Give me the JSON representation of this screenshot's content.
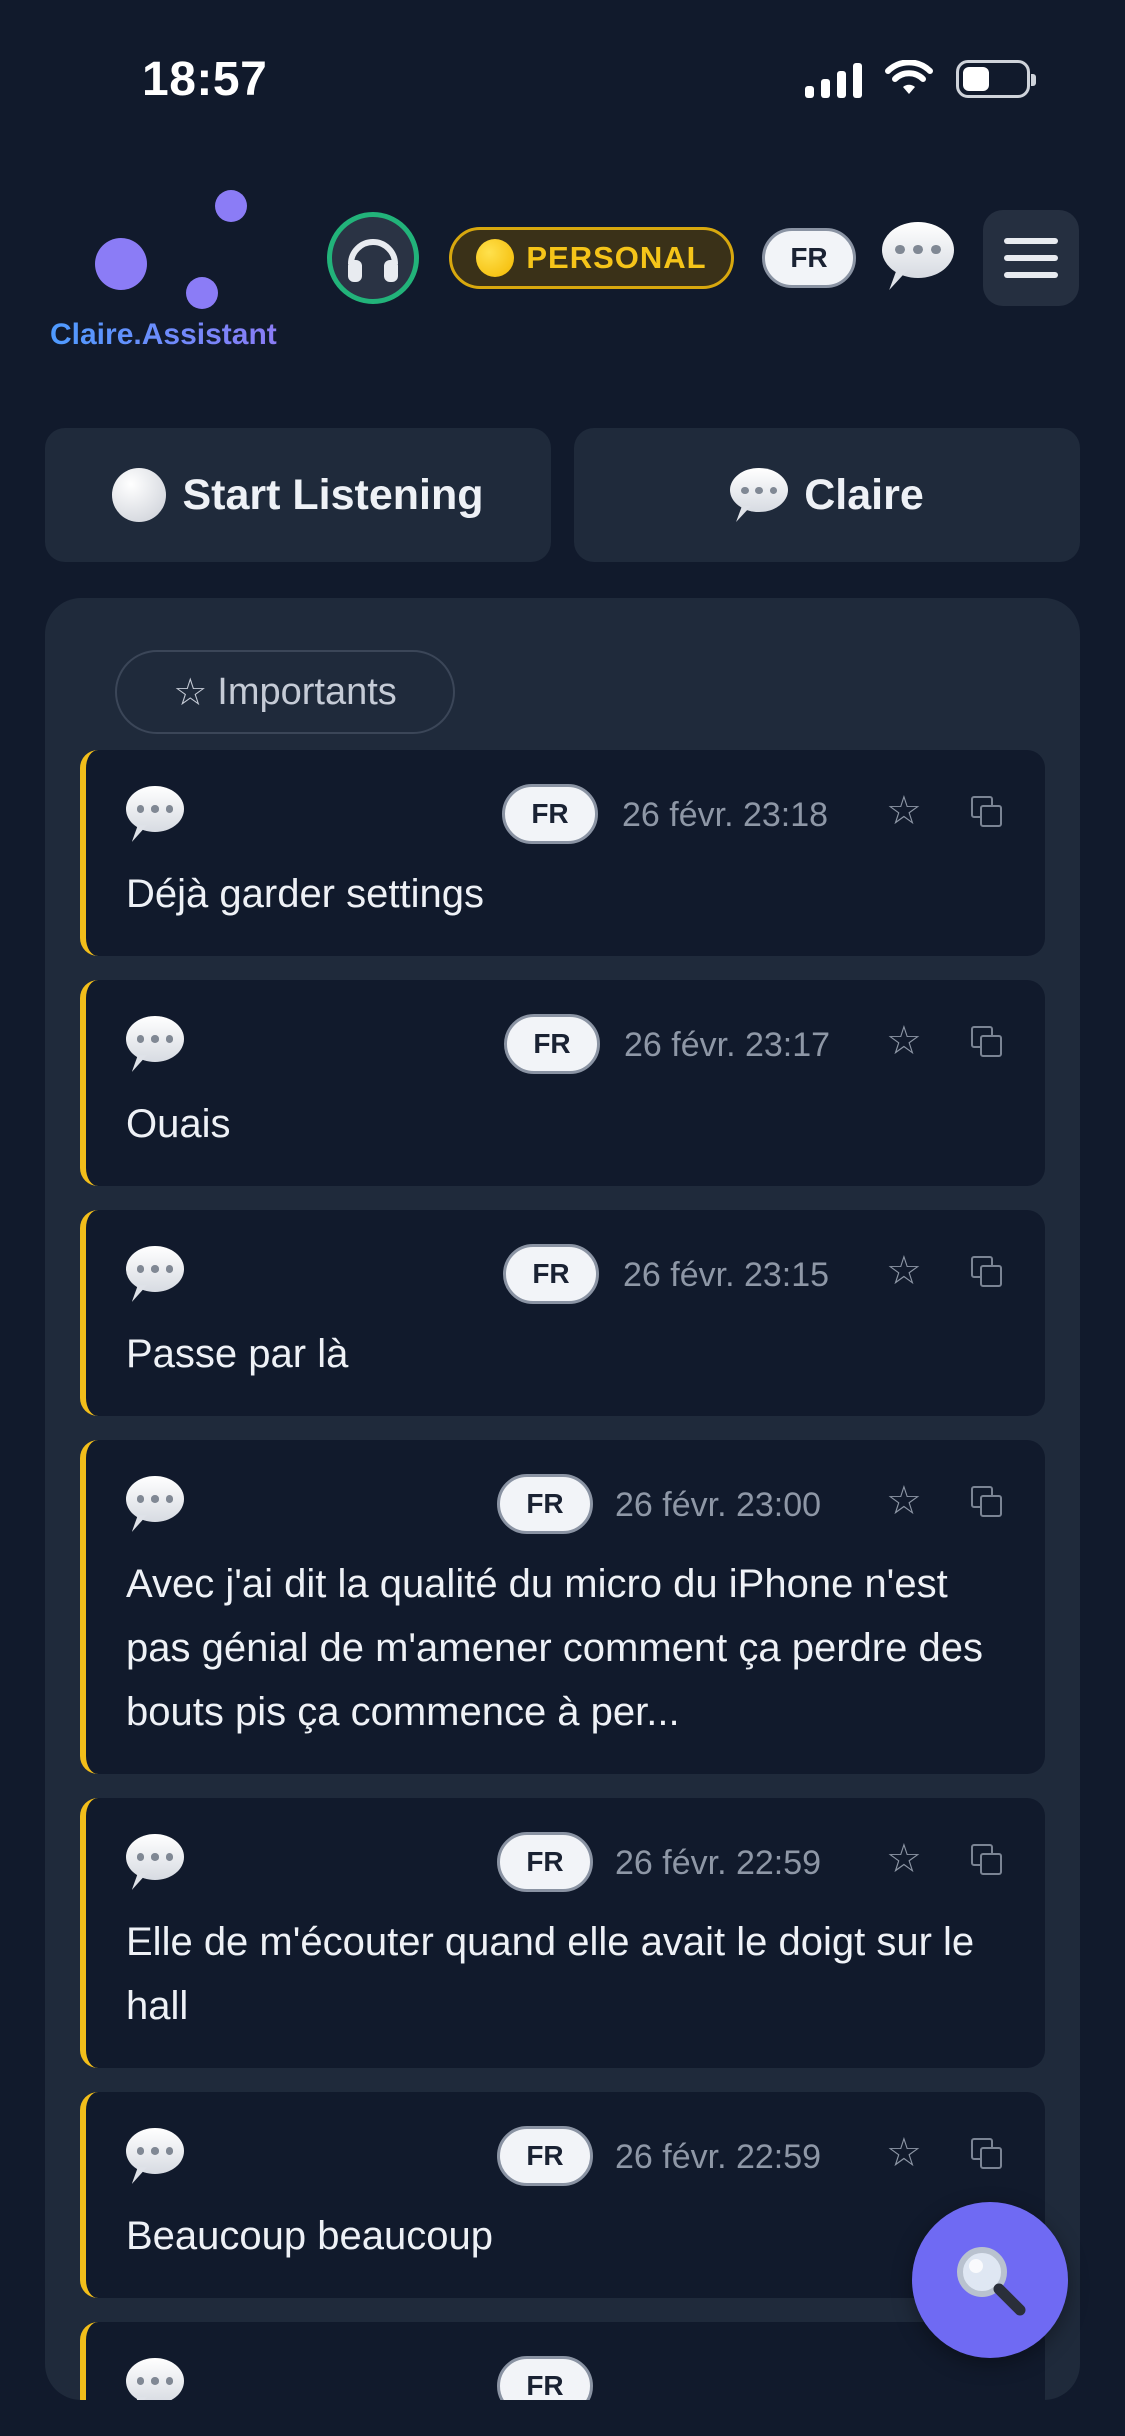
{
  "status_bar": {
    "time": "18:57"
  },
  "header": {
    "logo_text": "Claire.Assistant",
    "mode_badge": "PERSONAL",
    "language": "FR"
  },
  "actions": {
    "start_listening": "Start Listening",
    "claire": "Claire"
  },
  "filters": {
    "importants": "Importants"
  },
  "messages": [
    {
      "lang": "FR",
      "date": "26 févr. 23:18",
      "text": "Déjà garder settings"
    },
    {
      "lang": "FR",
      "date": "26 févr. 23:17",
      "text": "Ouais"
    },
    {
      "lang": "FR",
      "date": "26 févr. 23:15",
      "text": "Passe par là"
    },
    {
      "lang": "FR",
      "date": "26 févr. 23:00",
      "text": "Avec j'ai dit la qualité du micro du iPhone n'est pas génial de m'amener comment ça perdre des bouts pis ça commence à per..."
    },
    {
      "lang": "FR",
      "date": "26 févr. 22:59",
      "text": "Elle de m'écouter quand elle avait le doigt sur le hall"
    },
    {
      "lang": "FR",
      "date": "26 févr. 22:59",
      "text": "Beaucoup beaucoup"
    },
    {
      "lang": "FR",
      "date": "",
      "text": ""
    }
  ],
  "colors": {
    "accent": "#6f6af3",
    "card_border": "#f2be1a",
    "badge": "#f5c419",
    "headset_ring": "#22b37a"
  }
}
